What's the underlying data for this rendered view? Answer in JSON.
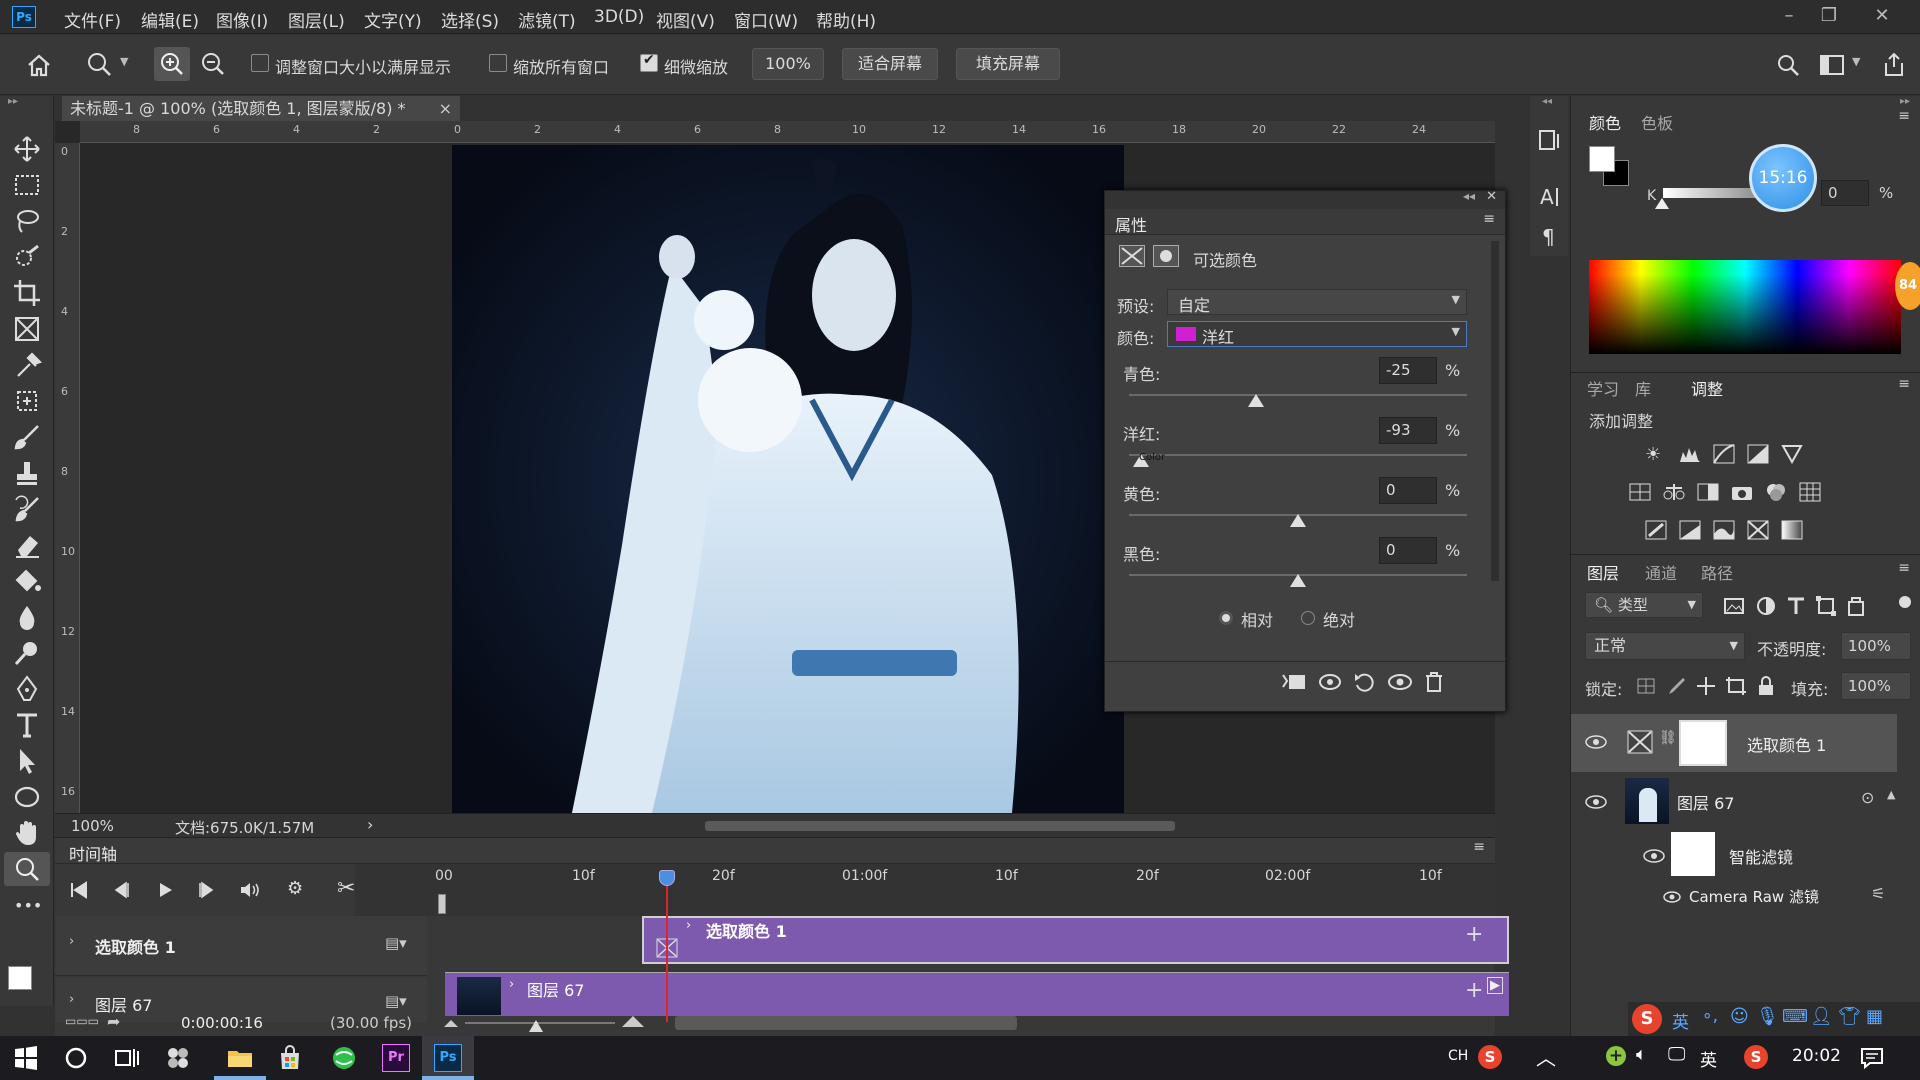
{
  "app": {
    "logo": "Ps"
  },
  "menu": [
    "文件(F)",
    "编辑(E)",
    "图像(I)",
    "图层(L)",
    "文字(Y)",
    "选择(S)",
    "滤镜(T)",
    "3D(D)",
    "视图(V)",
    "窗口(W)",
    "帮助(H)"
  ],
  "options": {
    "resize_windows": "调整窗口大小以满屏显示",
    "zoom_all": "缩放所有窗口",
    "scrubby_zoom": "细微缩放",
    "zoom_value": "100%",
    "fit_screen": "适合屏幕",
    "fill_screen": "填充屏幕"
  },
  "document": {
    "tab_title": "未标题-1 @ 100% (选取颜色 1, 图层蒙版/8) *",
    "close": "×"
  },
  "rulers": {
    "top": [
      "8",
      "6",
      "4",
      "2",
      "0",
      "2",
      "4",
      "6",
      "8",
      "10",
      "12",
      "14",
      "16",
      "18",
      "20",
      "22",
      "24"
    ],
    "left": [
      "0",
      "2",
      "4",
      "6",
      "8",
      "10",
      "12",
      "14",
      "16"
    ]
  },
  "status": {
    "zoom": "100%",
    "doc": "文档:675.0K/1.57M",
    "arrow": "›"
  },
  "properties": {
    "title": "属性",
    "panel_name": "可选颜色",
    "preset_label": "预设:",
    "preset_value": "自定",
    "color_label": "颜色:",
    "color_value": "洋红",
    "color_swatch": "#d020d0",
    "sliders": [
      {
        "label": "青色:",
        "value": "-25",
        "unit": "%",
        "level": -25
      },
      {
        "label": "洋红:",
        "value": "-93",
        "unit": "%",
        "level": -93
      },
      {
        "label": "黄色:",
        "value": "0",
        "unit": "%",
        "level": 0
      },
      {
        "label": "黑色:",
        "value": "0",
        "unit": "%",
        "level": 0
      }
    ],
    "method_relative": "相对",
    "method_absolute": "绝对",
    "cursor_text": "Color"
  },
  "color_panel": {
    "tabs": [
      "颜色",
      "色板"
    ],
    "k_label": "K",
    "k_value": "0",
    "unit": "%",
    "clock": "15:16",
    "badge": "84"
  },
  "adjustments": {
    "tabs": [
      "学习",
      "库",
      "调整"
    ],
    "add_label": "添加调整"
  },
  "layers": {
    "tabs": [
      "图层",
      "通道",
      "路径"
    ],
    "filter_type": "类型",
    "blend_mode": "正常",
    "opacity_label": "不透明度:",
    "opacity_value": "100%",
    "lock_label": "锁定:",
    "fill_label": "填充:",
    "fill_value": "100%",
    "items": [
      {
        "name": "选取颜色 1"
      },
      {
        "name": "图层 67"
      },
      {
        "name": "智能滤镜"
      },
      {
        "name": "Camera Raw 滤镜"
      }
    ]
  },
  "timeline": {
    "title": "时间轴",
    "ticks": [
      "00",
      "10f",
      "20f",
      "01:00f",
      "10f",
      "20f",
      "02:00f",
      "10f"
    ],
    "tracks": [
      {
        "name": "选取颜色 1",
        "clip": "选取颜色 1"
      },
      {
        "name": "图层 67",
        "clip": "图层 67"
      }
    ],
    "timecode": "0:00:00:16",
    "fps": "(30.00 fps)",
    "clip_color": "#7e5aae"
  },
  "taskbar": {
    "ime": "CH",
    "lang": "英",
    "time": "20:02",
    "sogou_lang": "英"
  }
}
